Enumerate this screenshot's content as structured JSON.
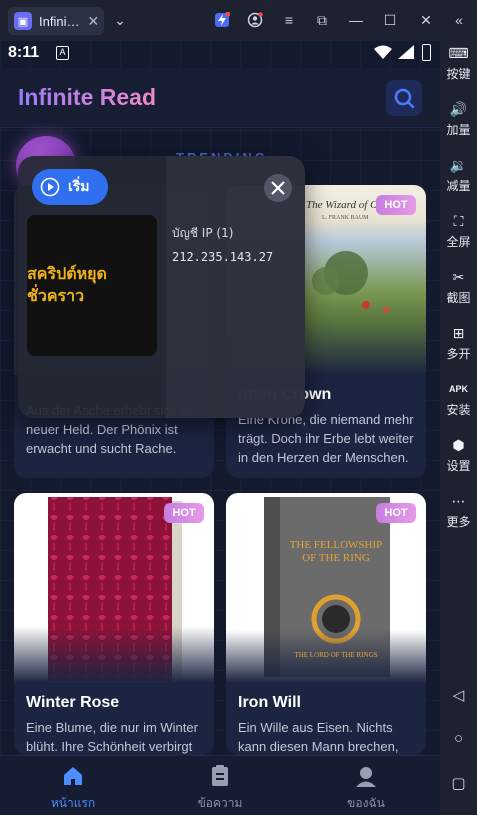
{
  "window": {
    "tab_title": "Infini…",
    "tab_close": "✕",
    "tab_icon_glyph": "▣"
  },
  "sidebar": {
    "items": [
      {
        "label": "按键",
        "icon": "keyboard-icon"
      },
      {
        "label": "加量",
        "icon": "volume-up-icon"
      },
      {
        "label": "减量",
        "icon": "volume-down-icon"
      },
      {
        "label": "全屏",
        "icon": "fullscreen-icon"
      },
      {
        "label": "截图",
        "icon": "scissors-icon"
      },
      {
        "label": "多开",
        "icon": "multi-instance-icon"
      },
      {
        "label": "安装",
        "icon": "apk-install-icon"
      },
      {
        "label": "设置",
        "icon": "settings-icon"
      },
      {
        "label": "更多",
        "icon": "more-icon"
      }
    ]
  },
  "status": {
    "time": "8:11",
    "sim": "A"
  },
  "app": {
    "title": "Infinite Read",
    "trending_label": "TRENDING",
    "accent": "#2f6ff0"
  },
  "cards": [
    {
      "title": "",
      "desc": "Aus der Asche erhebt sich ein neuer Held. Der Phönix ist erwacht und sucht Rache.",
      "hot": ""
    },
    {
      "title": "otten Crown",
      "desc": "Eine Krone, die niemand mehr trägt. Doch ihr Erbe lebt weiter in den Herzen der Menschen.",
      "hot": "HOT",
      "cover_caption": "The Wizard of Oz",
      "cover_author": "L. FRANK BAUM"
    },
    {
      "title": "Winter Rose",
      "desc": "Eine Blume, die nur im Winter blüht. Ihre Schönheit verbirgt",
      "hot": "HOT"
    },
    {
      "title": "Iron Will",
      "desc": "Ein Wille aus Eisen. Nichts kann diesen Mann brechen,",
      "hot": "HOT",
      "cover_caption": "THE FELLOWSHIP OF THE RING",
      "cover_sub": "THE LORD OF THE RINGS"
    }
  ],
  "overlay": {
    "start_label": "เริ่ม",
    "script_text": "สคริปต์หยุดชั่วคราว",
    "account_label": "บัญชี IP (1)",
    "ip": "212.235.143.27"
  },
  "bottom_nav": [
    {
      "label": "หน้าแรก",
      "icon": "home-icon",
      "active": true
    },
    {
      "label": "ข้อความ",
      "icon": "message-icon",
      "active": false
    },
    {
      "label": "ของฉัน",
      "icon": "profile-icon",
      "active": false
    }
  ]
}
